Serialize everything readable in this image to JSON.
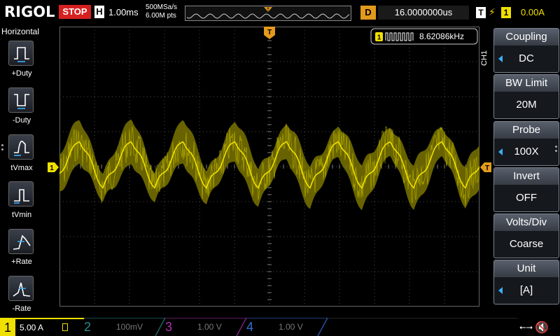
{
  "topbar": {
    "brand": "RIGOL",
    "run_state": "STOP",
    "h_label": "H",
    "timebase": "1.00ms",
    "sample_rate": "500MSa/s",
    "memory_depth": "6.00M pts",
    "trigger_marker": "T",
    "d_label": "D",
    "delay": "16.0000000us",
    "t_label": "T",
    "trigger_edge_icon": "rising-edge-icon",
    "trigger_source": "1",
    "trigger_level": "0.00A"
  },
  "left_panel": {
    "title": "Horizontal",
    "items": [
      {
        "label": "+Duty",
        "icon": "positive-duty-icon"
      },
      {
        "label": "-Duty",
        "icon": "negative-duty-icon"
      },
      {
        "label": "tVmax",
        "icon": "time-vmax-icon"
      },
      {
        "label": "tVmin",
        "icon": "time-vmin-icon"
      },
      {
        "label": "+Rate",
        "icon": "rise-rate-icon"
      },
      {
        "label": "-Rate",
        "icon": "fall-rate-icon"
      }
    ]
  },
  "scope": {
    "trigger_marker": "T",
    "channel_marker": "1",
    "trigger_level_marker": "T",
    "frequency_counter": {
      "channel": "1",
      "value": "8.62086kHz"
    },
    "colors": {
      "ch1": "#f0e000",
      "trigger": "#e39a1c",
      "grid": "#555555"
    }
  },
  "right_menu": {
    "channel_tab": "CH1",
    "items": [
      {
        "title": "Coupling",
        "value": "DC",
        "arrow": true
      },
      {
        "title": "BW Limit",
        "value": "20M",
        "arrow": false
      },
      {
        "title": "Probe",
        "value": "100X",
        "arrow": true
      },
      {
        "title": "Invert",
        "value": "OFF",
        "arrow": false
      },
      {
        "title": "Volts/Div",
        "value": "Coarse",
        "arrow": false
      },
      {
        "title": "Unit",
        "value": "[A]",
        "arrow": true
      }
    ]
  },
  "bottom": {
    "ch1": {
      "num": "1",
      "scale": "5.00 A"
    },
    "ch2": {
      "num": "2",
      "scale": "100mV",
      "color": "#2a8a8a"
    },
    "ch3": {
      "num": "3",
      "scale": "1.00 V",
      "color": "#b030b0"
    },
    "ch4": {
      "num": "4",
      "scale": "1.00 V",
      "color": "#3070d0"
    },
    "usb_icon": "usb-icon",
    "sound_icon": "speaker-muted-icon"
  }
}
